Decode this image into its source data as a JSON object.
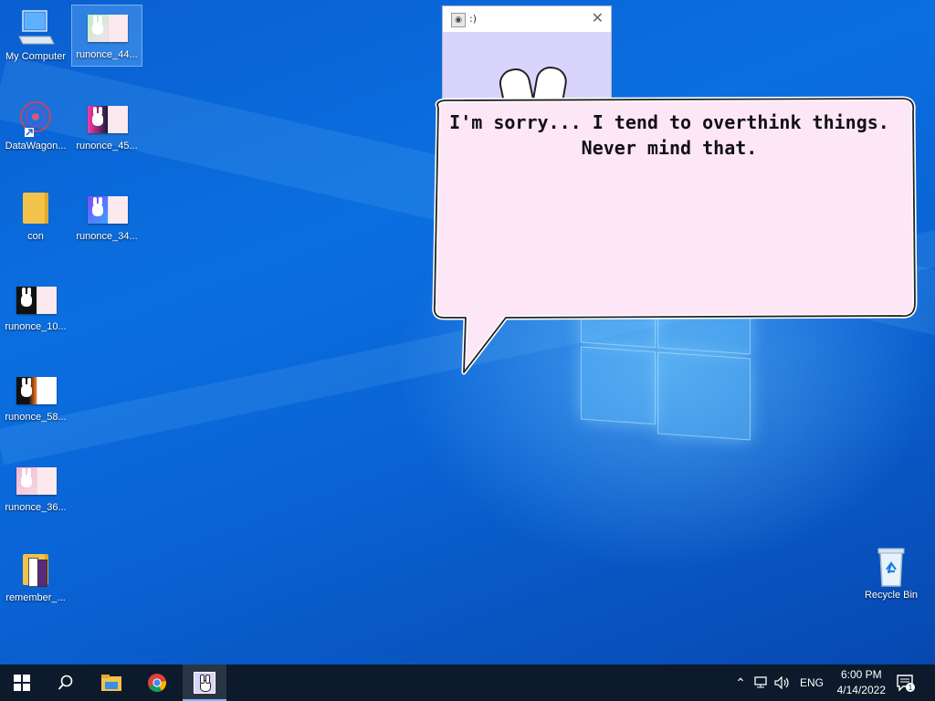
{
  "desktop": {
    "icons": [
      {
        "label": "My Computer"
      },
      {
        "label": "runonce_44..."
      },
      {
        "label": "DataWagon..."
      },
      {
        "label": "runonce_45..."
      },
      {
        "label": "con"
      },
      {
        "label": "runonce_34..."
      },
      {
        "label": "runonce_10..."
      },
      {
        "label": "runonce_58..."
      },
      {
        "label": "runonce_36..."
      },
      {
        "label": "remember_..."
      }
    ],
    "recycle_bin": {
      "label": "Recycle Bin"
    }
  },
  "popup_window": {
    "title": ":)"
  },
  "speech_bubble": {
    "line1": "I'm sorry... I tend to overthink things.",
    "line2": "Never mind that."
  },
  "taskbar": {
    "apps": [
      "start-icon",
      "search-icon",
      "file-explorer-icon",
      "chrome-icon",
      "bunny-app-icon"
    ],
    "language": "ENG",
    "time": "6:00 PM",
    "date": "4/14/2022",
    "notification_count": "1"
  },
  "colors": {
    "desktop_blue": "#0b6fe0",
    "taskbar": "#0d1a2b",
    "bubble_fill": "#fde6f6",
    "popup_bg": "#d8d4fb"
  }
}
